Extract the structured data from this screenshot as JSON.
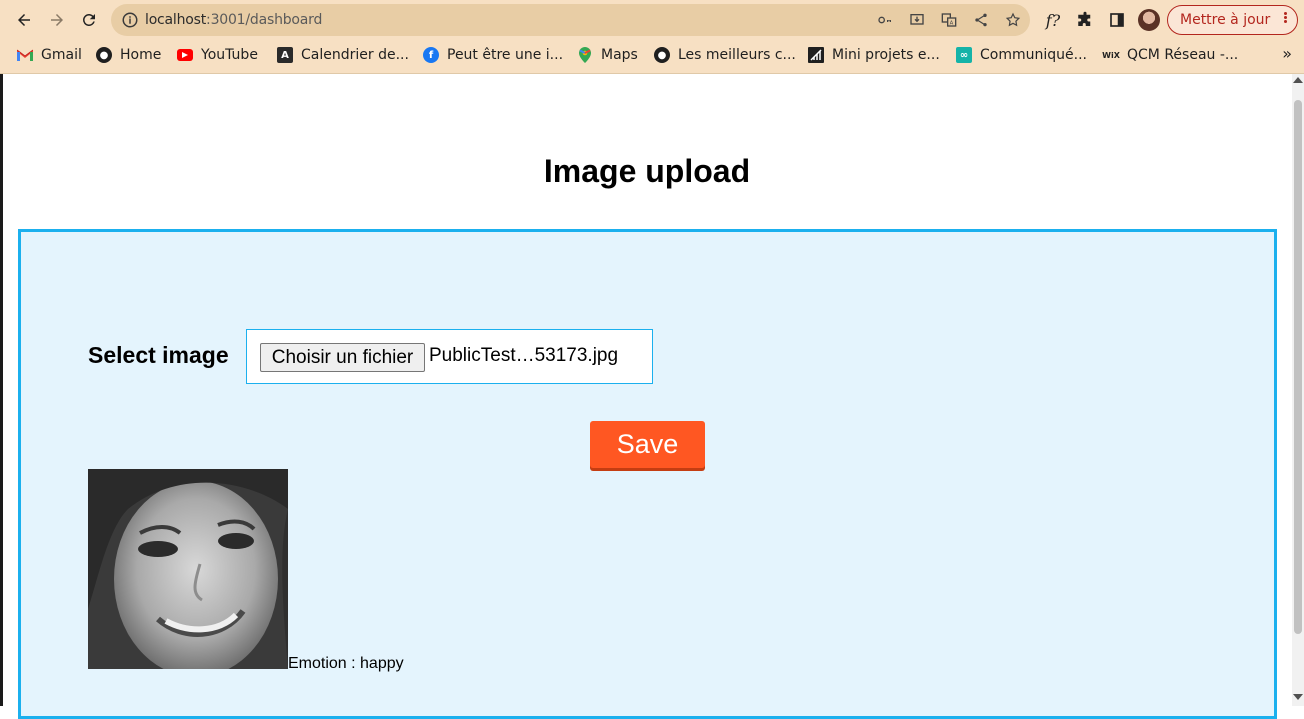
{
  "browser": {
    "url_host": "localhost",
    "url_path": ":3001/dashboard",
    "update_label": "Mettre à jour",
    "extension_label": "f?"
  },
  "bookmarks": [
    {
      "label": "Gmail",
      "icon": "gmail-icon"
    },
    {
      "label": "Home",
      "icon": "globe-icon"
    },
    {
      "label": "YouTube",
      "icon": "youtube-icon"
    },
    {
      "label": "Calendrier de...",
      "icon": "angular-icon"
    },
    {
      "label": "Peut être une i...",
      "icon": "facebook-icon"
    },
    {
      "label": "Maps",
      "icon": "maps-pin-icon"
    },
    {
      "label": "Les meilleurs c...",
      "icon": "globe-icon"
    },
    {
      "label": "Mini projets e...",
      "icon": "chart-icon"
    },
    {
      "label": "Communiqué...",
      "icon": "link-icon"
    },
    {
      "label": "QCM Réseau -...",
      "icon": "wix-icon"
    }
  ],
  "page": {
    "title": "Image upload",
    "select_label": "Select image",
    "choose_button": "Choisir un fichier",
    "file_name": "PublicTest…53173.jpg",
    "save_button": "Save",
    "emotion_text": "Emotion : happy"
  },
  "colors": {
    "chrome_bg": "#f7e0c3",
    "panel_bg": "#e4f4fd",
    "panel_border": "#1bb0ee",
    "save_button": "#ff5722",
    "update_accent": "#b3261e"
  }
}
